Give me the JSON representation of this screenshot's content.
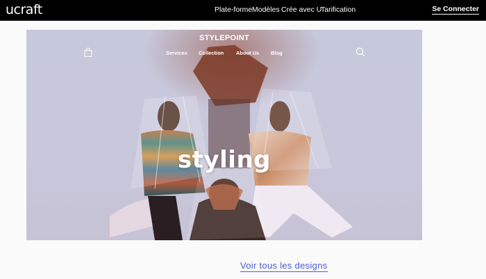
{
  "topbar": {
    "logo": "ucraft",
    "nav": [
      "Plate-forme",
      "Modèles",
      "Crée avec U",
      "Tarification"
    ],
    "signin": "Se Connecter"
  },
  "hero": {
    "brand": "STYLEPOINT",
    "nav": [
      "Services",
      "Collection",
      "About Us",
      "Blog"
    ],
    "headline": "styling",
    "icons": [
      "shopping-bag-icon",
      "search-icon"
    ]
  },
  "footer": {
    "view_all": "Voir tous les designs"
  },
  "colors": {
    "topbar_bg": "#000000",
    "link": "#4a5bd6",
    "hero_bg": "#c7c6da"
  }
}
